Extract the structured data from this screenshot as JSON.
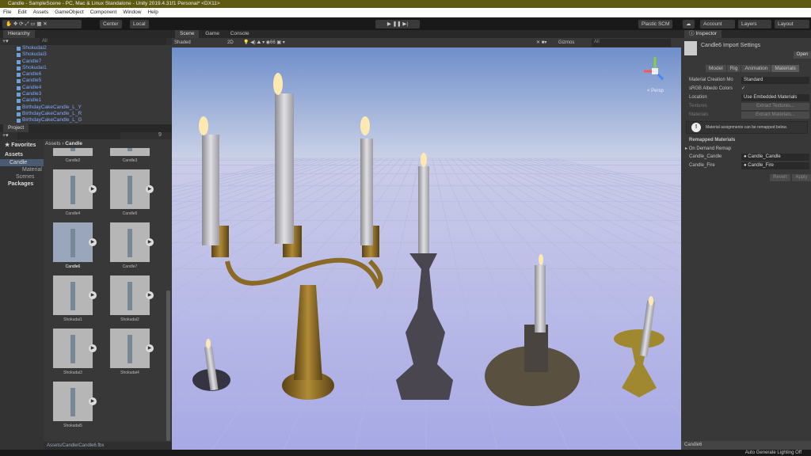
{
  "title": "Candle - SampleScene - PC, Mac & Linux Standalone - Unity 2019.4.31f1 Personal* <DX11>",
  "menu": [
    "File",
    "Edit",
    "Assets",
    "GameObject",
    "Component",
    "Window",
    "Help"
  ],
  "toolbar": {
    "center": "Center",
    "local": "Local",
    "plastic": "Plastic SCM",
    "account": "Account",
    "layers": "Layers",
    "layout": "Layout"
  },
  "hierarchy": {
    "tab": "Hierarchy",
    "search_placeholder": "All",
    "items": [
      "Shokudai2",
      "Shokudai3",
      "Candle7",
      "Shokudai1",
      "Candle6",
      "Candle5",
      "Candle4",
      "Candle3",
      "Candle1",
      "BirthdayCakeCandle_L_Y",
      "BirthdayCakeCandle_L_R",
      "BirthdayCakeCandle_L_G"
    ]
  },
  "project": {
    "tab": "Project",
    "favorites": "Favorites",
    "tree": [
      "Assets",
      "Candle",
      "Material",
      "Scenes",
      "Packages"
    ],
    "breadcrumb": [
      "Assets",
      "Candle"
    ],
    "count": "9",
    "assets": [
      "Candle2",
      "Candle3",
      "Candle4",
      "Candle5",
      "Candle6",
      "Candle7",
      "Shokudai1",
      "Shokudai2",
      "Shokudai3",
      "Shokudai4",
      "Shokudai5"
    ],
    "selected": "Candle6",
    "path": "Assets/Candle/Candle6.fbx"
  },
  "scene": {
    "tabs": [
      "Scene",
      "Game",
      "Console"
    ],
    "shading": "Shaded",
    "mode2d": "2D",
    "gizmos": "Gizmos",
    "search_placeholder": "All",
    "persp": "< Persp"
  },
  "inspector": {
    "tab": "Inspector",
    "title": "Candle6 Import Settings",
    "open": "Open",
    "tabs": [
      "Model",
      "Rig",
      "Animation",
      "Materials"
    ],
    "active_tab": "Materials",
    "rows": [
      {
        "label": "Material Creation Mo",
        "value": "Standard"
      },
      {
        "label": "sRGB Albedo Colors",
        "value": "✓"
      },
      {
        "label": "Location",
        "value": "Use Embedded Materials"
      },
      {
        "label": "Textures",
        "value": "Extract Textures..."
      },
      {
        "label": "Materials",
        "value": "Extract Materials..."
      }
    ],
    "info": "Material assignments can be remapped below.",
    "remapped": "Remapped Materials",
    "on_demand": "On Demand Remap",
    "remaps": [
      {
        "label": "Candle_Candle",
        "value": "Candle_Candle"
      },
      {
        "label": "Candle_Fire",
        "value": "Candle_Fire"
      }
    ],
    "revert": "Revert",
    "apply": "Apply",
    "footer": "Candle6"
  },
  "status": "Auto Generate Lighting Off"
}
